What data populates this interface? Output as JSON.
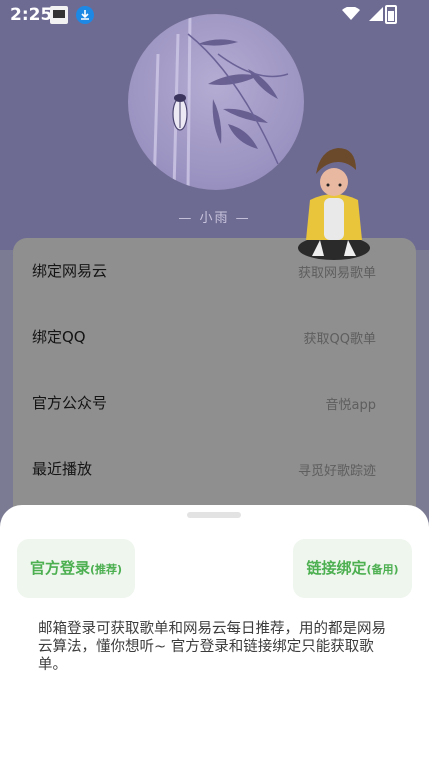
{
  "status_bar": {
    "time": "2:25"
  },
  "profile": {
    "nickname": "— 小雨 —"
  },
  "menu": [
    {
      "title": "绑定网易云",
      "subtitle": "获取网易歌单"
    },
    {
      "title": "绑定QQ",
      "subtitle": "获取QQ歌单"
    },
    {
      "title": "官方公众号",
      "subtitle": "音悦app"
    },
    {
      "title": "最近播放",
      "subtitle": "寻觅好歌踪迹"
    }
  ],
  "sheet": {
    "official_login": {
      "label": "官方登录",
      "tag": "(推荐)"
    },
    "link_bind": {
      "label": "链接绑定",
      "tag": "(备用)"
    },
    "description": "邮箱登录可获取歌单和网易云每日推荐，用的都是网易云算法，懂你想听~ 官方登录和链接绑定只能获取歌单。"
  },
  "colors": {
    "accent_green": "#4caf50",
    "header_purple": "#6e6b93"
  }
}
